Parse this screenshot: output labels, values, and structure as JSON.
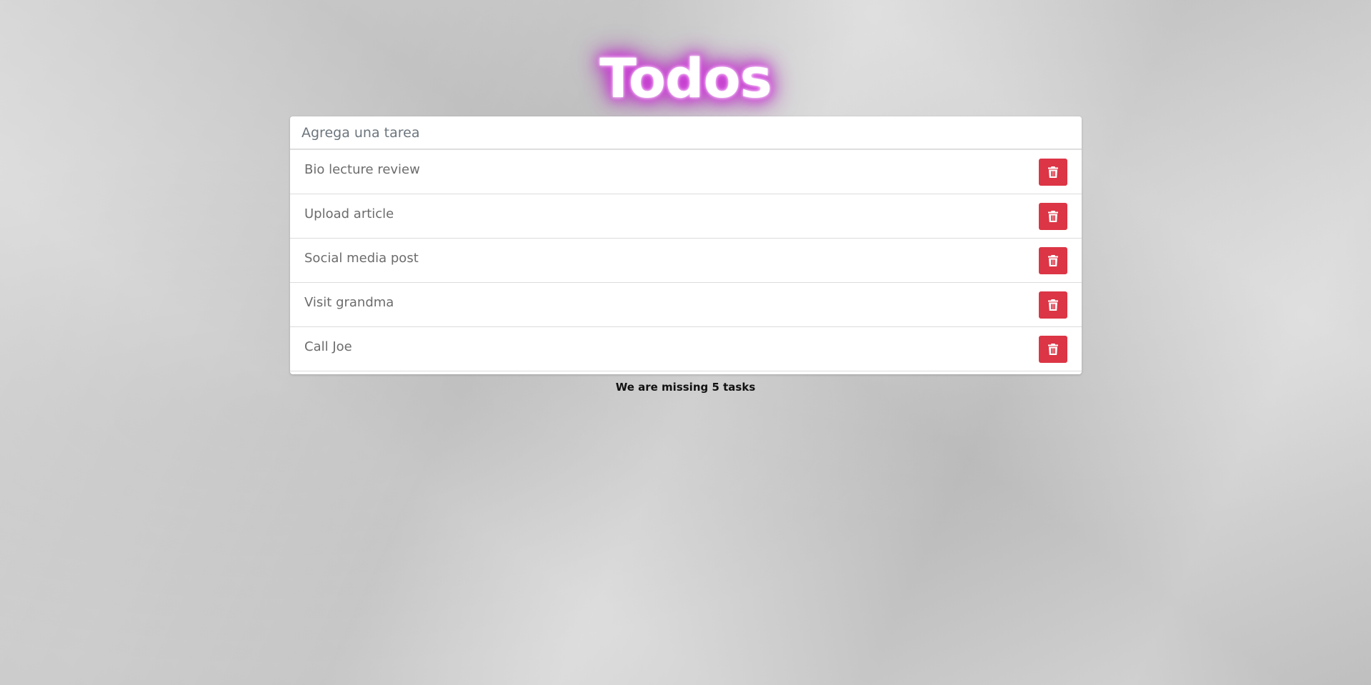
{
  "header": {
    "title": "Todos"
  },
  "new_todo": {
    "placeholder": "Agrega una tarea",
    "value": ""
  },
  "todos": [
    {
      "label": "Bio lecture review",
      "delete_icon": "trash-icon"
    },
    {
      "label": "Upload article",
      "delete_icon": "trash-icon"
    },
    {
      "label": "Social media post",
      "delete_icon": "trash-icon"
    },
    {
      "label": "Visit grandma",
      "delete_icon": "trash-icon"
    },
    {
      "label": "Call Joe",
      "delete_icon": "trash-icon"
    }
  ],
  "footer": {
    "counter_text": "We are missing 5 tasks"
  },
  "colors": {
    "title_glow": "#cc33d6",
    "delete_button": "#dc3545",
    "background": "#d3d3d3"
  }
}
